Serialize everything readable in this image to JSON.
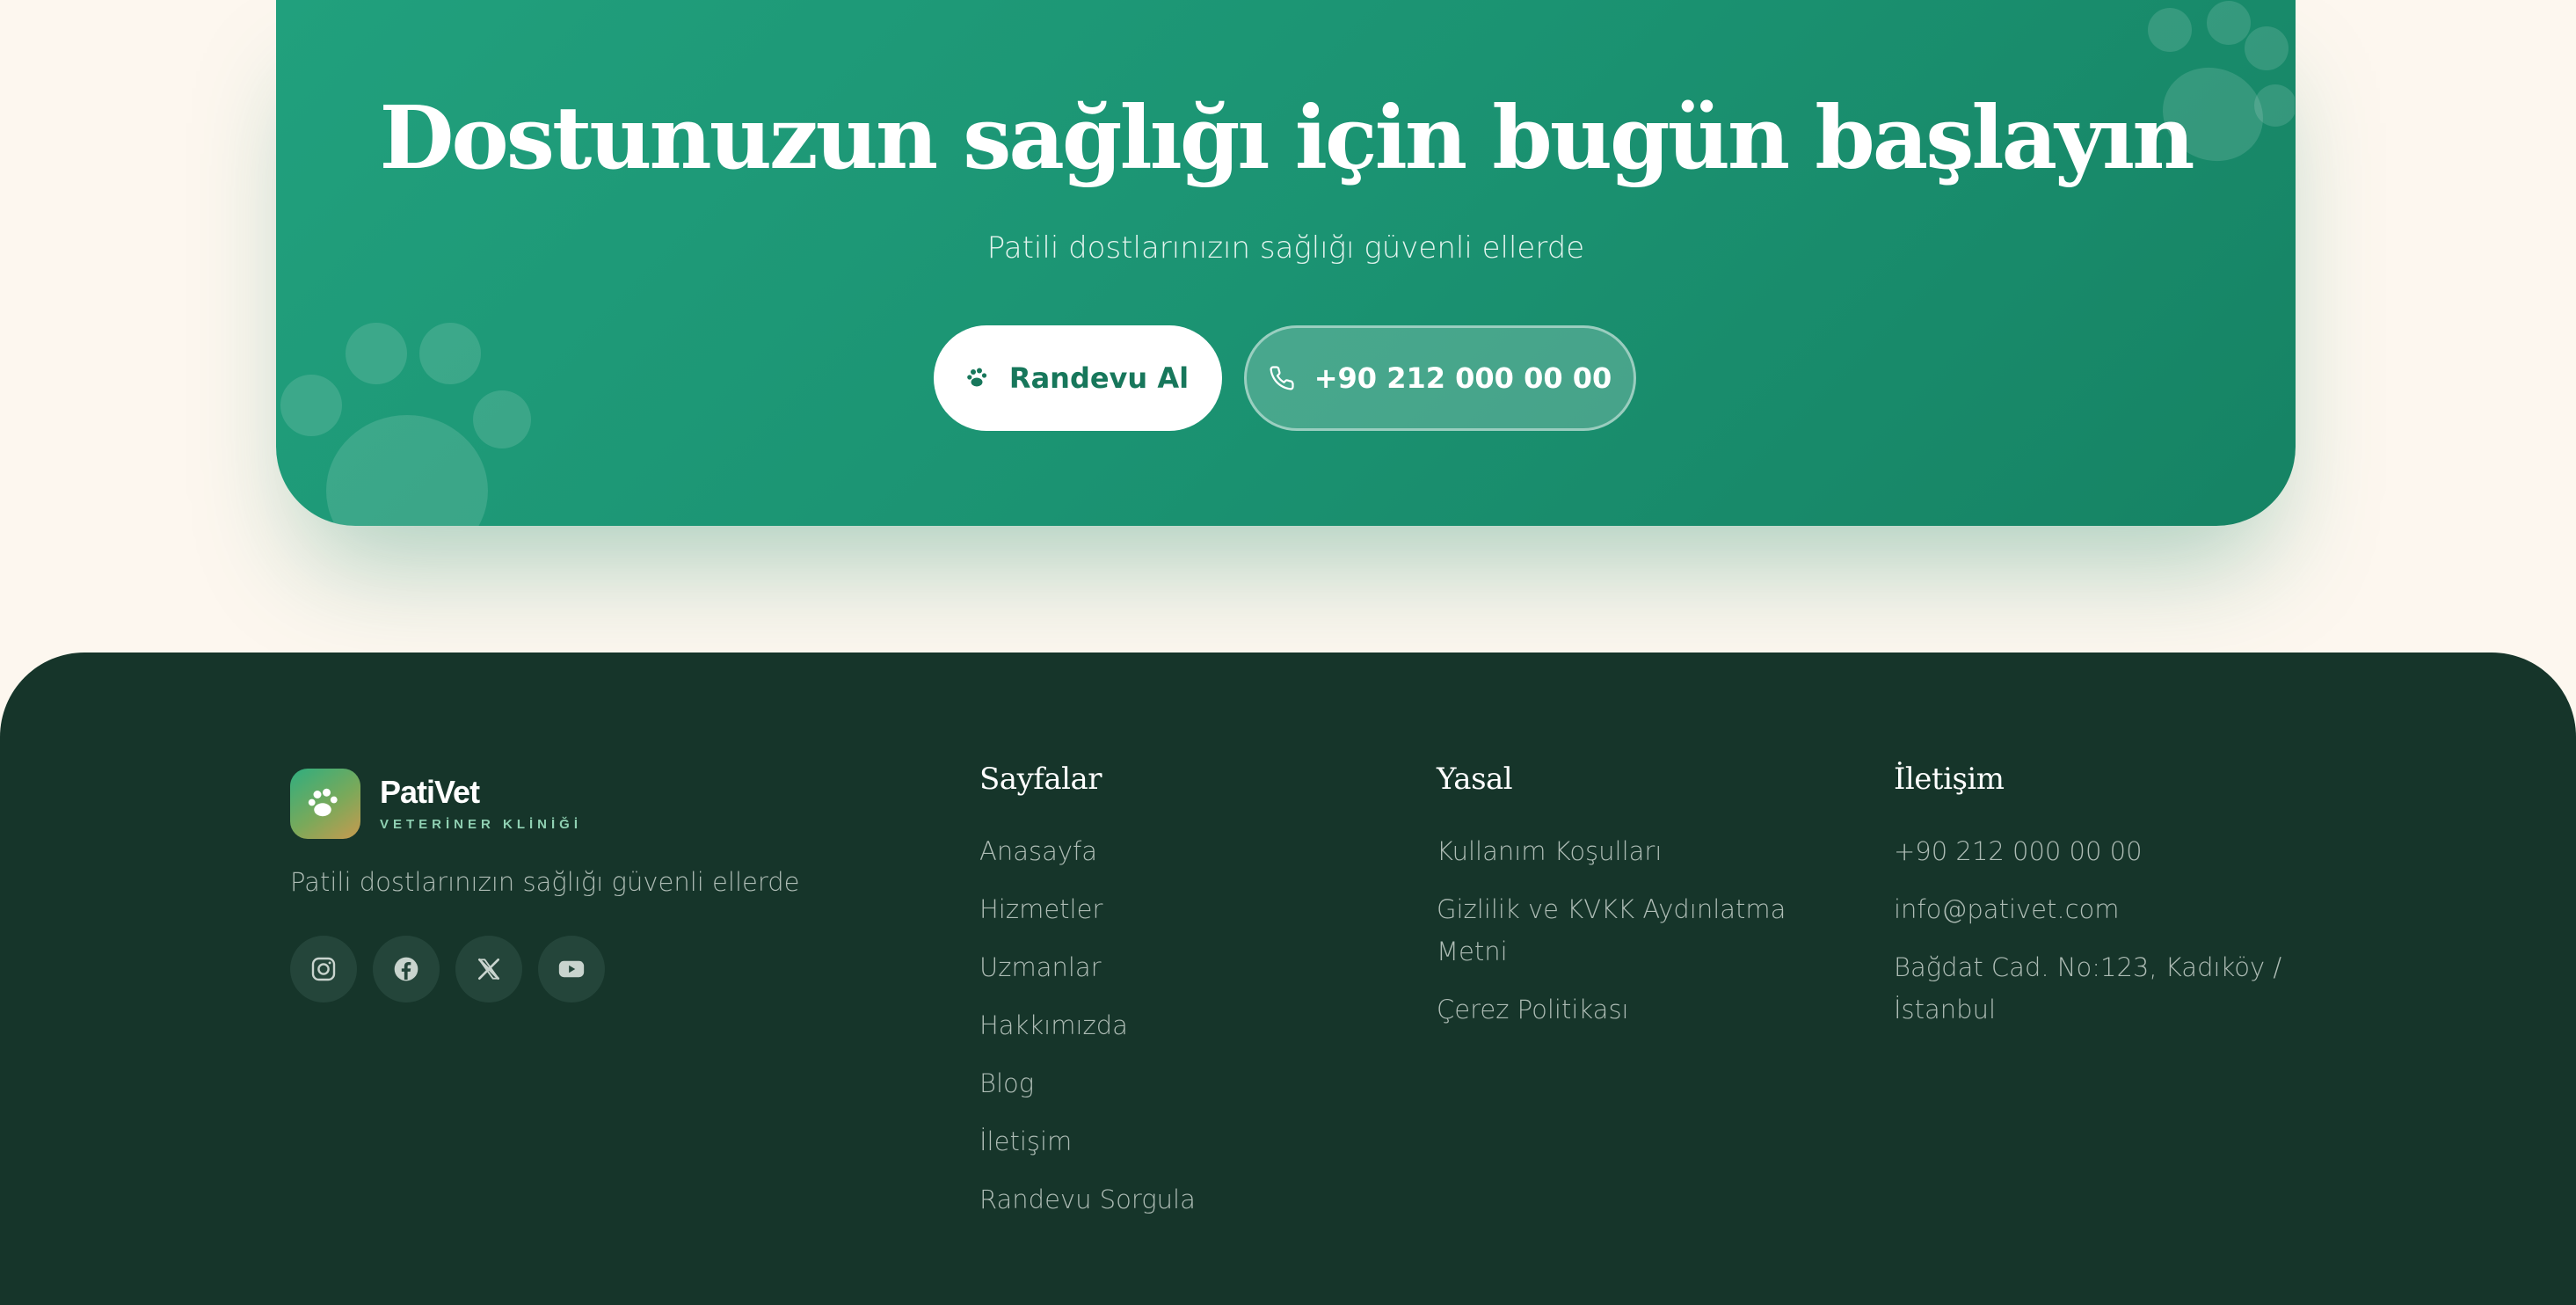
{
  "cta": {
    "title": "Dostunuzun sağlığı için bugün başlayın",
    "subtitle": "Patili dostlarınızın sağlığı güvenli ellerde",
    "primary_button": "Randevu Al",
    "secondary_button": "+90 212 000 00 00"
  },
  "brand": {
    "name": "PatiVet",
    "tagline": "VETERİNER KLİNİĞİ",
    "description": "Patili dostlarınızın sağlığı güvenli ellerde"
  },
  "socials": [
    {
      "icon": "instagram-icon"
    },
    {
      "icon": "facebook-icon"
    },
    {
      "icon": "x-twitter-icon"
    },
    {
      "icon": "youtube-icon"
    }
  ],
  "pages": {
    "heading": "Sayfalar",
    "items": [
      "Anasayfa",
      "Hizmetler",
      "Uzmanlar",
      "Hakkımızda",
      "Blog",
      "İletişim",
      "Randevu Sorgula"
    ]
  },
  "legal": {
    "heading": "Yasal",
    "items": [
      "Kullanım Koşulları",
      "Gizlilik ve KVKK Aydınlatma Metni",
      "Çerez Politikası"
    ]
  },
  "contact": {
    "heading": "İletişim",
    "items": [
      "+90 212 000 00 00",
      "info@pativet.com",
      "Bağdat Cad. No:123, Kadıköy / İstanbul"
    ]
  },
  "colors": {
    "cta_green": "#1b9372",
    "footer_bg": "#16352a",
    "page_bg": "#fdf7ef",
    "accent_text": "#17775b"
  }
}
